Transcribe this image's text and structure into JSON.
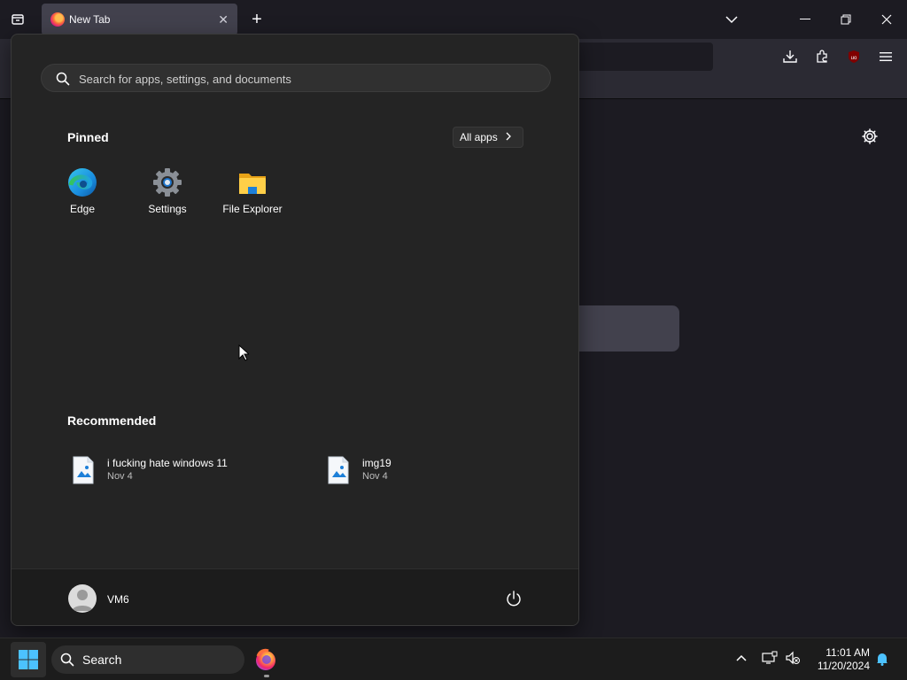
{
  "browser": {
    "tab": {
      "title": "New Tab",
      "close": "✕"
    },
    "new_tab": "+",
    "window_controls": {
      "minimize": "—",
      "restore": "❐",
      "close": "✕"
    }
  },
  "start_menu": {
    "search": {
      "placeholder": "Search for apps, settings, and documents"
    },
    "pinned": {
      "title": "Pinned",
      "all_apps_label": "All apps",
      "items": [
        {
          "label": "Edge",
          "icon": "edge-icon"
        },
        {
          "label": "Settings",
          "icon": "settings-gear-icon"
        },
        {
          "label": "File Explorer",
          "icon": "folder-icon"
        }
      ]
    },
    "recommended": {
      "title": "Recommended",
      "items": [
        {
          "name": "i fucking hate windows 11",
          "date": "Nov 4",
          "icon": "image-file-icon"
        },
        {
          "name": "img19",
          "date": "Nov 4",
          "icon": "image-file-icon"
        }
      ]
    },
    "user": {
      "name": "VM6"
    }
  },
  "taskbar": {
    "search_label": "Search",
    "clock": {
      "time": "11:01 AM",
      "date": "11/20/2024"
    }
  },
  "colors": {
    "accent_blue": "#4cc2ff",
    "start_bg": "#242424",
    "firefox_chrome": "#2b2a33"
  }
}
